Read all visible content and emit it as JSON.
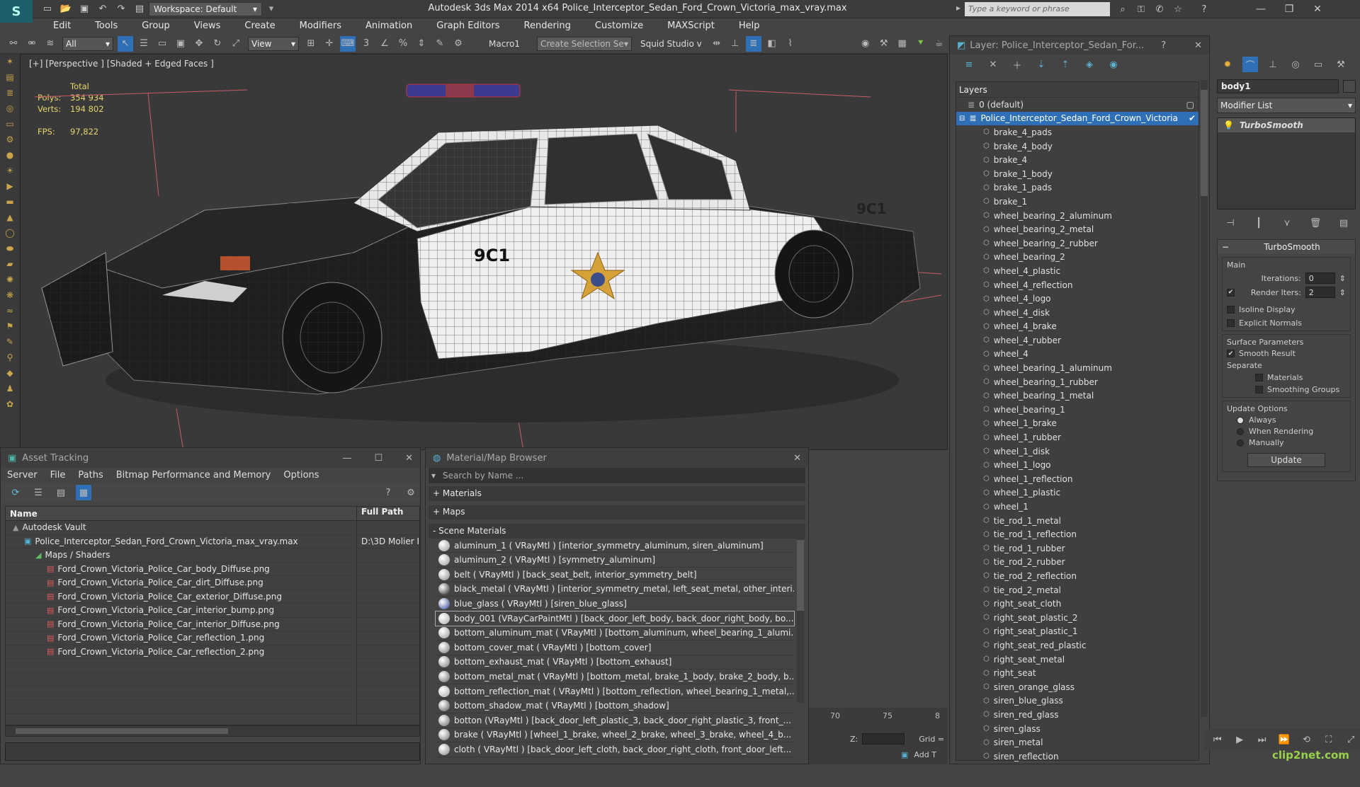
{
  "titlebar": {
    "workspace": "Workspace: Default",
    "app_title": "Autodesk 3ds Max  2014 x64     Police_Interceptor_Sedan_Ford_Crown_Victoria_max_vray.max",
    "search_placeholder": "Type a keyword or phrase"
  },
  "menubar": [
    "Edit",
    "Tools",
    "Group",
    "Views",
    "Create",
    "Modifiers",
    "Animation",
    "Graph Editors",
    "Rendering",
    "Customize",
    "MAXScript",
    "Help"
  ],
  "toolbar": {
    "selection_filter": "All",
    "ref_coord": "View",
    "macro_label": "Macro1",
    "create_selection_set": "Create Selection Se",
    "squid_studio": "Squid Studio v"
  },
  "viewport": {
    "label": "[+] [Perspective ] [Shaded + Edged Faces ]",
    "stats": {
      "total_label": "Total",
      "polys_label": "Polys:",
      "polys_value": "354 934",
      "verts_label": "Verts:",
      "verts_value": "194 802",
      "fps_label": "FPS:",
      "fps_value": "97,822"
    },
    "car_decals": {
      "unit_number": "9C1",
      "rear_text": "9C1"
    }
  },
  "asset_tracking": {
    "title": "Asset Tracking",
    "menu": [
      "Server",
      "File",
      "Paths",
      "Bitmap Performance and Memory",
      "Options"
    ],
    "columns": [
      "Name",
      "Full Path"
    ],
    "rows": [
      {
        "name": "Autodesk Vault",
        "path": "",
        "indent": 1,
        "icon": "vault"
      },
      {
        "name": "Police_Interceptor_Sedan_Ford_Crown_Victoria_max_vray.max",
        "path": "D:\\3D Molier I",
        "indent": 2,
        "icon": "max"
      },
      {
        "name": "Maps / Shaders",
        "path": "",
        "indent": 3,
        "icon": "maps"
      },
      {
        "name": "Ford_Crown_Victoria_Police_Car_body_Diffuse.png",
        "path": "",
        "indent": 4,
        "icon": "png"
      },
      {
        "name": "Ford_Crown_Victoria_Police_Car_dirt_Diffuse.png",
        "path": "",
        "indent": 4,
        "icon": "png"
      },
      {
        "name": "Ford_Crown_Victoria_Police_Car_exterior_Diffuse.png",
        "path": "",
        "indent": 4,
        "icon": "png"
      },
      {
        "name": "Ford_Crown_Victoria_Police_Car_interior_bump.png",
        "path": "",
        "indent": 4,
        "icon": "png"
      },
      {
        "name": "Ford_Crown_Victoria_Police_Car_interior_Diffuse.png",
        "path": "",
        "indent": 4,
        "icon": "png"
      },
      {
        "name": "Ford_Crown_Victoria_Police_Car_reflection_1.png",
        "path": "",
        "indent": 4,
        "icon": "png"
      },
      {
        "name": "Ford_Crown_Victoria_Police_Car_reflection_2.png",
        "path": "",
        "indent": 4,
        "icon": "png"
      }
    ]
  },
  "material_browser": {
    "title": "Material/Map Browser",
    "search_placeholder": "Search by Name ...",
    "sections": [
      "+ Materials",
      "+ Maps",
      "- Scene Materials"
    ],
    "materials": [
      "aluminum_1  ( VRayMtl ) [interior_symmetry_aluminum, siren_aluminum]",
      "aluminum_2  ( VRayMtl ) [symmetry_aluminum]",
      "belt  ( VRayMtl ) [back_seat_belt, interior_symmetry_belt]",
      "black_metal  ( VRayMtl ) [interior_symmetry_metal, left_seat_metal, other_interi...",
      "blue_glass  ( VRayMtl ) [siren_blue_glass]",
      "body_001 (VRayCarPaintMtl ) [back_door_left_body, back_door_right_body, bo...",
      "bottom_aluminum_mat  ( VRayMtl ) [bottom_aluminum, wheel_bearing_1_alumi...",
      "bottom_cover_mat  ( VRayMtl ) [bottom_cover]",
      "bottom_exhaust_mat  ( VRayMtl ) [bottom_exhaust]",
      "bottom_metal_mat  ( VRayMtl ) [bottom_metal, brake_1_body, brake_2_body, b...",
      "bottom_reflection_mat  ( VRayMtl ) [bottom_reflection, wheel_bearing_1_metal,...",
      "bottom_shadow_mat  ( VRayMtl ) [bottom_shadow]",
      "botton (VRayMtl ) [back_door_left_plastic_3, back_door_right_plastic_3, front_...",
      "brake  ( VRayMtl )  [wheel_1_brake, wheel_2_brake, wheel_3_brake, wheel_4_b...",
      "cloth  ( VRayMtl ) [back_door_left_cloth, back_door_right_cloth, front_door_left..."
    ]
  },
  "timeline": {
    "ticks": [
      "70",
      "75",
      "8"
    ],
    "z_label": "Z:",
    "grid_label": "Grid =",
    "add_t": "Add T"
  },
  "layers": {
    "title": "Layer: Police_Interceptor_Sedan_For...",
    "help": "?",
    "header": "Layers",
    "default_layer": "0 (default)",
    "selected_layer": "Police_Interceptor_Sedan_Ford_Crown_Victoria",
    "items": [
      "brake_4_pads",
      "brake_4_body",
      "brake_4",
      "brake_1_body",
      "brake_1_pads",
      "brake_1",
      "wheel_bearing_2_aluminum",
      "wheel_bearing_2_metal",
      "wheel_bearing_2_rubber",
      "wheel_bearing_2",
      "wheel_4_plastic",
      "wheel_4_reflection",
      "wheel_4_logo",
      "wheel_4_disk",
      "wheel_4_brake",
      "wheel_4_rubber",
      "wheel_4",
      "wheel_bearing_1_aluminum",
      "wheel_bearing_1_rubber",
      "wheel_bearing_1_metal",
      "wheel_bearing_1",
      "wheel_1_brake",
      "wheel_1_rubber",
      "wheel_1_disk",
      "wheel_1_logo",
      "wheel_1_reflection",
      "wheel_1_plastic",
      "wheel_1",
      "tie_rod_1_metal",
      "tie_rod_1_reflection",
      "tie_rod_1_rubber",
      "tie_rod_2_rubber",
      "tie_rod_2_reflection",
      "tie_rod_2_metal",
      "right_seat_cloth",
      "right_seat_plastic_2",
      "right_seat_plastic_1",
      "right_seat_red_plastic",
      "right_seat_metal",
      "right_seat",
      "siren_orange_glass",
      "siren_blue_glass",
      "siren_red_glass",
      "siren_glass",
      "siren_metal",
      "siren_reflection"
    ]
  },
  "command_panel": {
    "object_name": "body1",
    "modifier_list": "Modifier List",
    "stack_item": "TurboSmooth",
    "rollout_title": "TurboSmooth",
    "main_label": "Main",
    "iterations_label": "Iterations:",
    "iterations_value": "0",
    "render_iters_label": "Render Iters:",
    "render_iters_value": "2",
    "render_iters_checked": true,
    "isoline_label": "Isoline Display",
    "explicit_normals_label": "Explicit Normals",
    "surface_params_label": "Surface Parameters",
    "smooth_result_label": "Smooth Result",
    "smooth_result_checked": true,
    "separate_label": "Separate",
    "materials_label": "Materials",
    "smoothing_groups_label": "Smoothing Groups",
    "update_options_label": "Update Options",
    "always_label": "Always",
    "when_rendering_label": "When Rendering",
    "manually_label": "Manually",
    "update_button": "Update"
  },
  "watermark": "clip2net.com",
  "colors": {
    "selection": "#2f6fb5",
    "stats": "#e6d56b",
    "accent": "#1d5f6a"
  }
}
